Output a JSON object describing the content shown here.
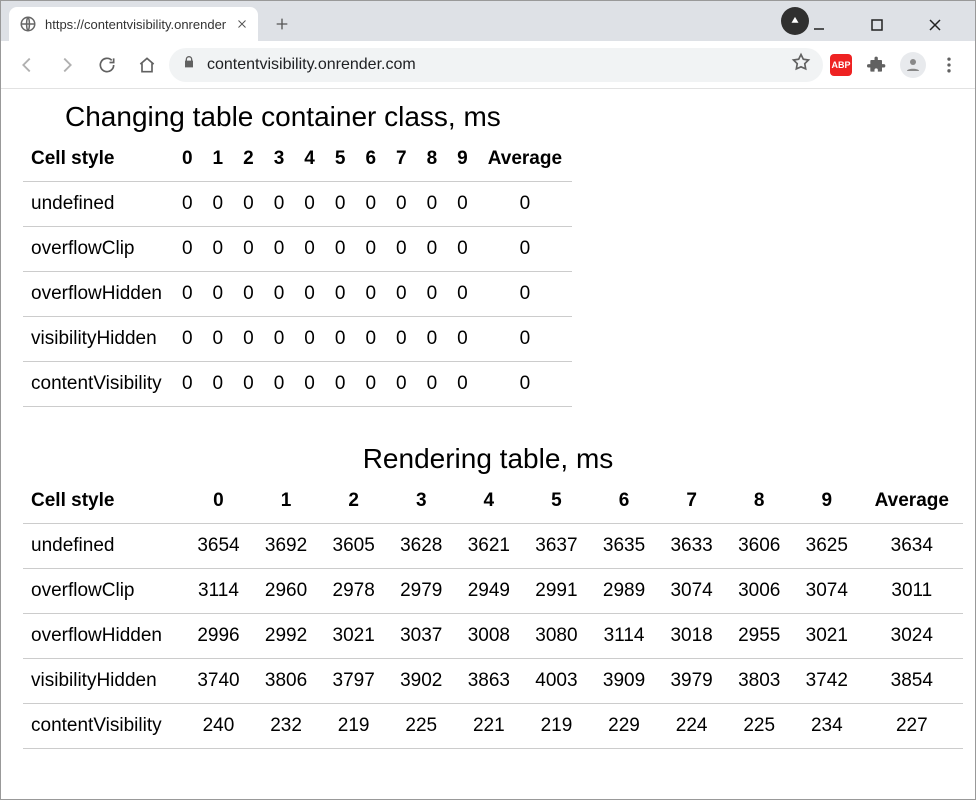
{
  "browser": {
    "tab_title": "https://contentvisibility.onrender",
    "url_display": "contentvisibility.onrender.com"
  },
  "table1": {
    "title": "Changing table container class, ms",
    "headers": [
      "Cell style",
      "0",
      "1",
      "2",
      "3",
      "4",
      "5",
      "6",
      "7",
      "8",
      "9",
      "Average"
    ],
    "rows": [
      {
        "label": "undefined",
        "v": [
          "0",
          "0",
          "0",
          "0",
          "0",
          "0",
          "0",
          "0",
          "0",
          "0"
        ],
        "avg": "0"
      },
      {
        "label": "overflowClip",
        "v": [
          "0",
          "0",
          "0",
          "0",
          "0",
          "0",
          "0",
          "0",
          "0",
          "0"
        ],
        "avg": "0"
      },
      {
        "label": "overflowHidden",
        "v": [
          "0",
          "0",
          "0",
          "0",
          "0",
          "0",
          "0",
          "0",
          "0",
          "0"
        ],
        "avg": "0"
      },
      {
        "label": "visibilityHidden",
        "v": [
          "0",
          "0",
          "0",
          "0",
          "0",
          "0",
          "0",
          "0",
          "0",
          "0"
        ],
        "avg": "0"
      },
      {
        "label": "contentVisibility",
        "v": [
          "0",
          "0",
          "0",
          "0",
          "0",
          "0",
          "0",
          "0",
          "0",
          "0"
        ],
        "avg": "0"
      }
    ]
  },
  "table2": {
    "title": "Rendering table, ms",
    "headers": [
      "Cell style",
      "0",
      "1",
      "2",
      "3",
      "4",
      "5",
      "6",
      "7",
      "8",
      "9",
      "Average"
    ],
    "rows": [
      {
        "label": "undefined",
        "v": [
          "3654",
          "3692",
          "3605",
          "3628",
          "3621",
          "3637",
          "3635",
          "3633",
          "3606",
          "3625"
        ],
        "avg": "3634"
      },
      {
        "label": "overflowClip",
        "v": [
          "3114",
          "2960",
          "2978",
          "2979",
          "2949",
          "2991",
          "2989",
          "3074",
          "3006",
          "3074"
        ],
        "avg": "3011"
      },
      {
        "label": "overflowHidden",
        "v": [
          "2996",
          "2992",
          "3021",
          "3037",
          "3008",
          "3080",
          "3114",
          "3018",
          "2955",
          "3021"
        ],
        "avg": "3024"
      },
      {
        "label": "visibilityHidden",
        "v": [
          "3740",
          "3806",
          "3797",
          "3902",
          "3863",
          "4003",
          "3909",
          "3979",
          "3803",
          "3742"
        ],
        "avg": "3854"
      },
      {
        "label": "contentVisibility",
        "v": [
          "240",
          "232",
          "219",
          "225",
          "221",
          "219",
          "229",
          "224",
          "225",
          "234"
        ],
        "avg": "227"
      }
    ]
  },
  "chart_data": [
    {
      "type": "table",
      "title": "Changing table container class, ms",
      "columns": [
        "Cell style",
        "0",
        "1",
        "2",
        "3",
        "4",
        "5",
        "6",
        "7",
        "8",
        "9",
        "Average"
      ],
      "rows": [
        [
          "undefined",
          0,
          0,
          0,
          0,
          0,
          0,
          0,
          0,
          0,
          0,
          0
        ],
        [
          "overflowClip",
          0,
          0,
          0,
          0,
          0,
          0,
          0,
          0,
          0,
          0,
          0
        ],
        [
          "overflowHidden",
          0,
          0,
          0,
          0,
          0,
          0,
          0,
          0,
          0,
          0,
          0
        ],
        [
          "visibilityHidden",
          0,
          0,
          0,
          0,
          0,
          0,
          0,
          0,
          0,
          0,
          0
        ],
        [
          "contentVisibility",
          0,
          0,
          0,
          0,
          0,
          0,
          0,
          0,
          0,
          0,
          0
        ]
      ]
    },
    {
      "type": "table",
      "title": "Rendering table, ms",
      "columns": [
        "Cell style",
        "0",
        "1",
        "2",
        "3",
        "4",
        "5",
        "6",
        "7",
        "8",
        "9",
        "Average"
      ],
      "rows": [
        [
          "undefined",
          3654,
          3692,
          3605,
          3628,
          3621,
          3637,
          3635,
          3633,
          3606,
          3625,
          3634
        ],
        [
          "overflowClip",
          3114,
          2960,
          2978,
          2979,
          2949,
          2991,
          2989,
          3074,
          3006,
          3074,
          3011
        ],
        [
          "overflowHidden",
          2996,
          2992,
          3021,
          3037,
          3008,
          3080,
          3114,
          3018,
          2955,
          3021,
          3024
        ],
        [
          "visibilityHidden",
          3740,
          3806,
          3797,
          3902,
          3863,
          4003,
          3909,
          3979,
          3803,
          3742,
          3854
        ],
        [
          "contentVisibility",
          240,
          232,
          219,
          225,
          221,
          219,
          229,
          224,
          225,
          234,
          227
        ]
      ]
    }
  ]
}
